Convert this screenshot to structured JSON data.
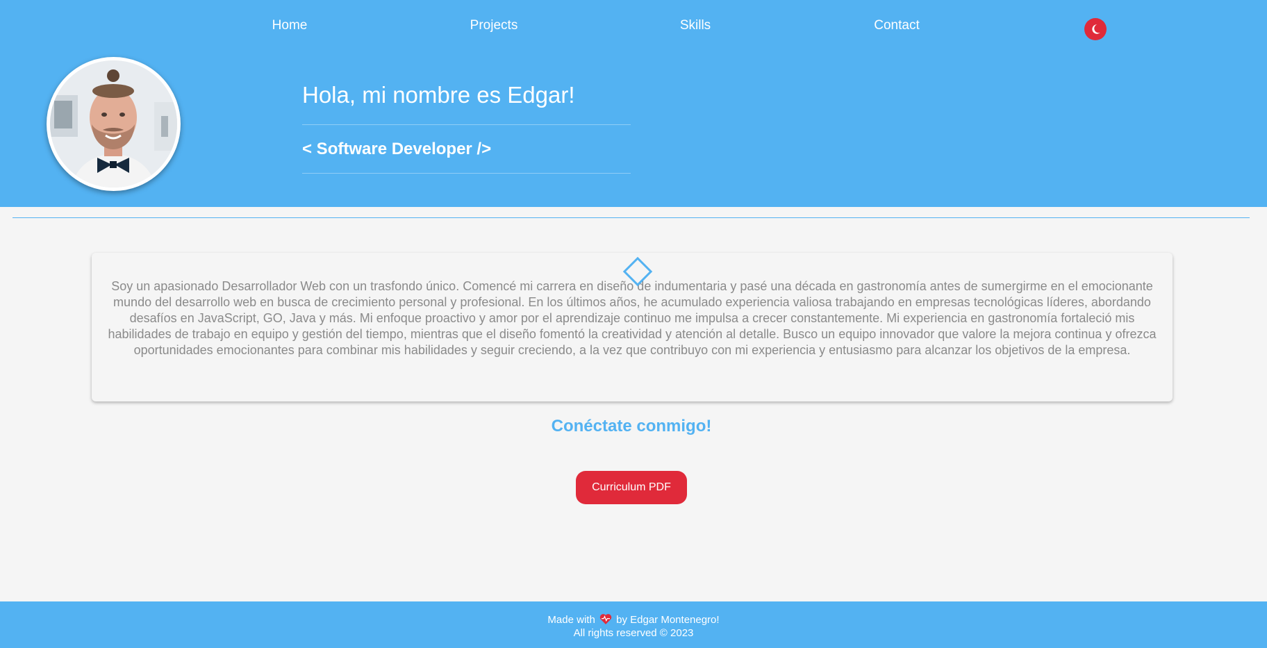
{
  "nav": {
    "items": [
      {
        "label": "Home"
      },
      {
        "label": "Projects"
      },
      {
        "label": "Skills"
      },
      {
        "label": "Contact"
      }
    ],
    "theme_icon": "moon-icon"
  },
  "hero": {
    "title": "Hola, mi nombre es Edgar!",
    "subtitle": "< Software Developer />"
  },
  "about": {
    "text": "Soy un apasionado Desarrollador Web con un trasfondo único. Comencé mi carrera en diseño de indumentaria y pasé una década en gastronomía antes de sumergirme en el emocionante mundo del desarrollo web en busca de crecimiento personal y profesional. En los últimos años, he acumulado experiencia valiosa trabajando en empresas tecnológicas líderes, abordando desafíos en JavaScript, GO, Java y más. Mi enfoque proactivo y amor por el aprendizaje continuo me impulsa a crecer constantemente. Mi experiencia en gastronomía fortaleció mis habilidades de trabajo en equipo y gestión del tiempo, mientras que el diseño fomentó la creatividad y atención al detalle. Busco un equipo innovador que valore la mejora continua y ofrezca oportunidades emocionantes para combinar mis habilidades y seguir creciendo, a la vez que contribuyo con mi experiencia y entusiasmo para alcanzar los objetivos de la empresa."
  },
  "connect": {
    "heading": "Conéctate conmigo!",
    "cv_button": "Curriculum PDF"
  },
  "footer": {
    "made_with": "Made with",
    "by": "by Edgar Montenegro!",
    "rights": "All rights reserved © 2023"
  },
  "colors": {
    "primary": "#53b2f2",
    "accent": "#e02a3a",
    "background": "#f5f5f5",
    "text_muted": "#8a8a8a"
  }
}
